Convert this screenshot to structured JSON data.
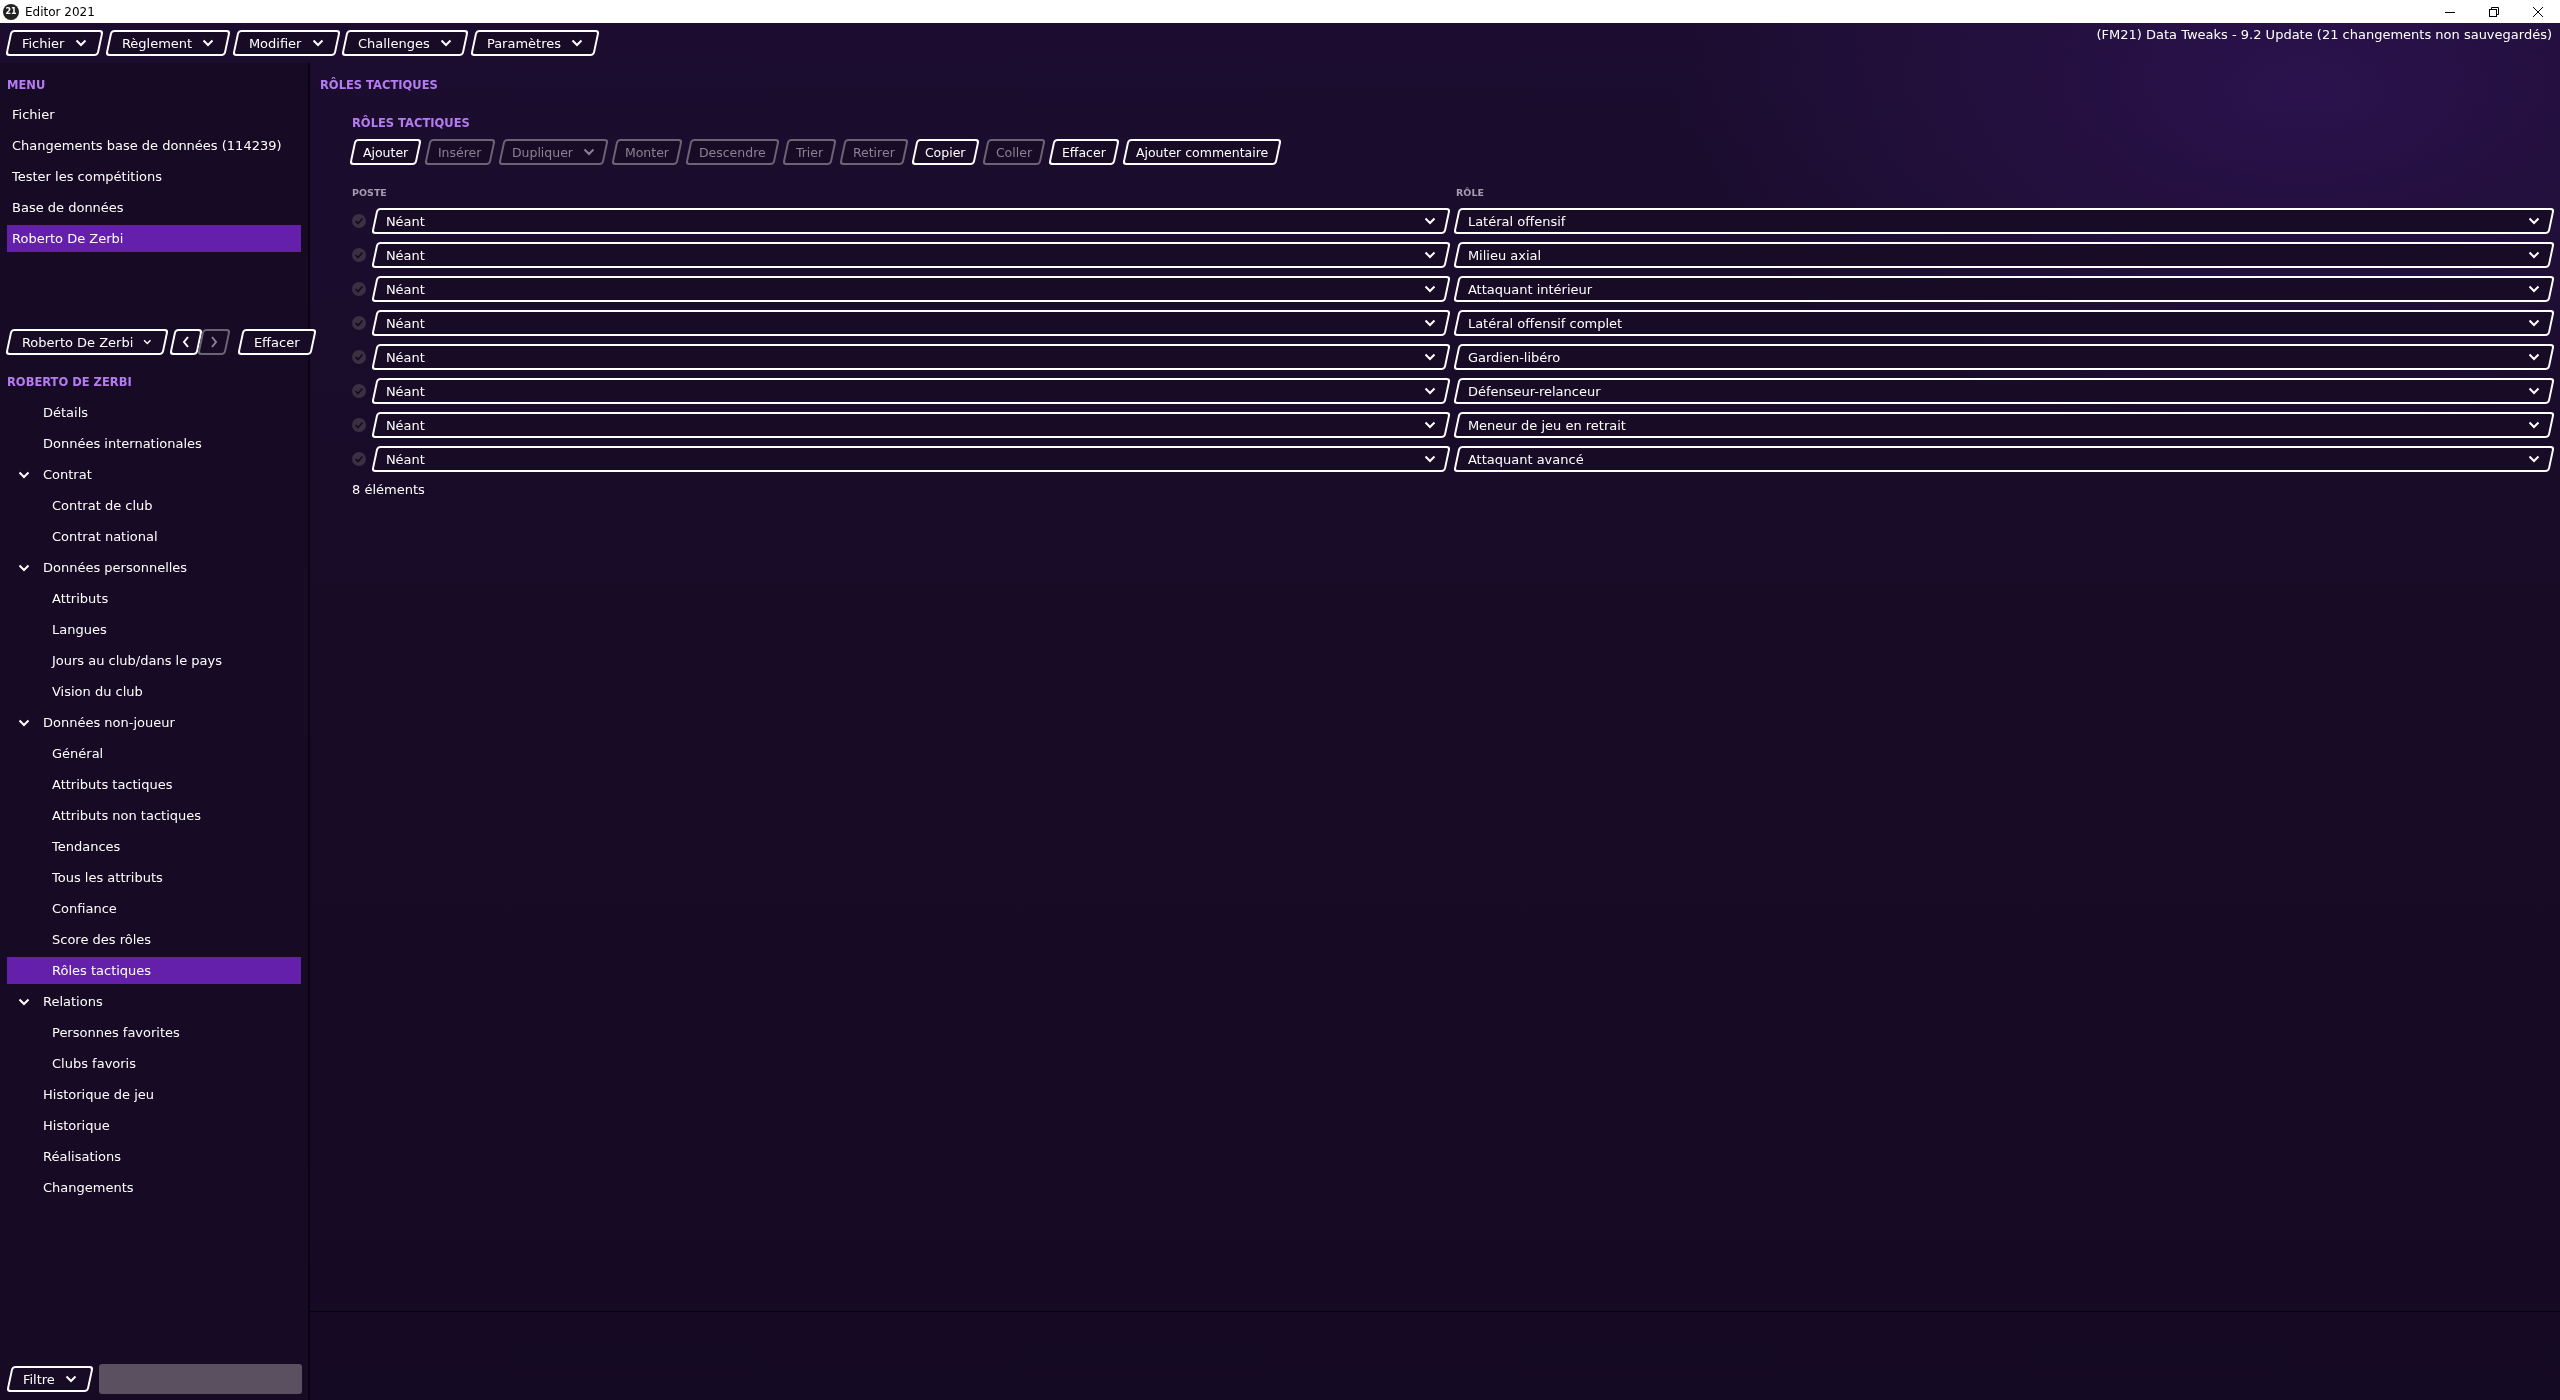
{
  "window": {
    "logo": "21",
    "title": "Editor 2021"
  },
  "menubar": [
    {
      "label": "Fichier"
    },
    {
      "label": "Règlement"
    },
    {
      "label": "Modifier"
    },
    {
      "label": "Challenges"
    },
    {
      "label": "Paramètres"
    }
  ],
  "project_status": "(FM21) Data Tweaks - 9.2 Update (21 changements non sauvegardés)",
  "sidebar": {
    "heading": "MENU",
    "items": [
      {
        "label": "Fichier",
        "selected": false
      },
      {
        "label": "Changements base de données (114239)",
        "selected": false
      },
      {
        "label": "Tester les compétitions",
        "selected": false
      },
      {
        "label": "Base de données",
        "selected": false
      },
      {
        "label": "Roberto De Zerbi",
        "selected": true
      }
    ],
    "person_picker": {
      "value": "Roberto De Zerbi",
      "prev_disabled": false,
      "next_disabled": true
    },
    "clear_button": "Effacer",
    "tree_heading": "ROBERTO DE ZERBI",
    "tree": [
      {
        "label": "Détails",
        "selected": false
      },
      {
        "label": "Données internationales",
        "selected": false
      },
      {
        "label": "Contrat",
        "selected": false,
        "expanded": true,
        "children": [
          {
            "label": "Contrat de club",
            "selected": false
          },
          {
            "label": "Contrat national",
            "selected": false
          }
        ]
      },
      {
        "label": "Données personnelles",
        "selected": false,
        "expanded": true,
        "children": [
          {
            "label": "Attributs",
            "selected": false
          },
          {
            "label": "Langues",
            "selected": false
          },
          {
            "label": "Jours au club/dans le pays",
            "selected": false
          },
          {
            "label": "Vision du club",
            "selected": false
          }
        ]
      },
      {
        "label": "Données non-joueur",
        "selected": false,
        "expanded": true,
        "children": [
          {
            "label": "Général",
            "selected": false
          },
          {
            "label": "Attributs tactiques",
            "selected": false
          },
          {
            "label": "Attributs non tactiques",
            "selected": false
          },
          {
            "label": "Tendances",
            "selected": false
          },
          {
            "label": "Tous les attributs",
            "selected": false
          },
          {
            "label": "Confiance",
            "selected": false
          },
          {
            "label": "Score des rôles",
            "selected": false
          },
          {
            "label": "Rôles tactiques",
            "selected": true
          }
        ]
      },
      {
        "label": "Relations",
        "selected": false,
        "expanded": true,
        "children": [
          {
            "label": "Personnes favorites",
            "selected": false
          },
          {
            "label": "Clubs favoris",
            "selected": false
          }
        ]
      },
      {
        "label": "Historique de jeu",
        "selected": false
      },
      {
        "label": "Historique",
        "selected": false
      },
      {
        "label": "Réalisations",
        "selected": false
      },
      {
        "label": "Changements",
        "selected": false
      }
    ],
    "filter": {
      "label": "Filtre"
    }
  },
  "content": {
    "heading": "RÔLES TACTIQUES",
    "section": {
      "heading": "RÔLES TACTIQUES",
      "toolbar": [
        {
          "label": "Ajouter",
          "disabled": false,
          "dropdown": false
        },
        {
          "label": "Insérer",
          "disabled": true,
          "dropdown": false
        },
        {
          "label": "Dupliquer",
          "disabled": true,
          "dropdown": true
        },
        {
          "label": "Monter",
          "disabled": true,
          "dropdown": false
        },
        {
          "label": "Descendre",
          "disabled": true,
          "dropdown": false
        },
        {
          "label": "Trier",
          "disabled": true,
          "dropdown": false
        },
        {
          "label": "Retirer",
          "disabled": true,
          "dropdown": false
        },
        {
          "label": "Copier",
          "disabled": false,
          "dropdown": false
        },
        {
          "label": "Coller",
          "disabled": true,
          "dropdown": false
        },
        {
          "label": "Effacer",
          "disabled": false,
          "dropdown": false
        },
        {
          "label": "Ajouter commentaire",
          "disabled": false,
          "dropdown": false
        }
      ],
      "columns": [
        "POSTE",
        "RÔLE"
      ],
      "rows": [
        {
          "position": "Néant",
          "role": "Latéral offensif"
        },
        {
          "position": "Néant",
          "role": "Milieu axial"
        },
        {
          "position": "Néant",
          "role": "Attaquant intérieur"
        },
        {
          "position": "Néant",
          "role": "Latéral offensif complet"
        },
        {
          "position": "Néant",
          "role": "Gardien-libéro"
        },
        {
          "position": "Néant",
          "role": "Défenseur-relanceur"
        },
        {
          "position": "Néant",
          "role": "Meneur de jeu en retrait"
        },
        {
          "position": "Néant",
          "role": "Attaquant avancé"
        }
      ],
      "count": "8 éléments"
    }
  }
}
